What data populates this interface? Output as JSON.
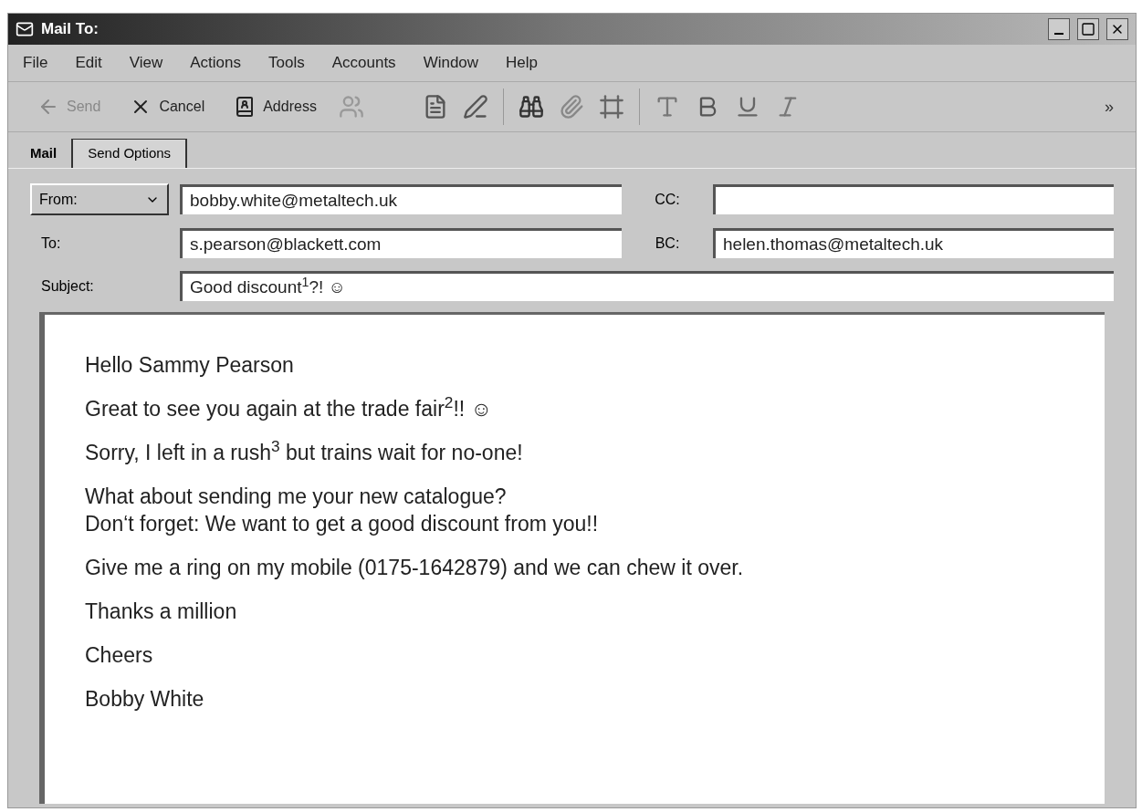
{
  "window": {
    "title": "Mail To:"
  },
  "menu": [
    "File",
    "Edit",
    "View",
    "Actions",
    "Tools",
    "Accounts",
    "Window",
    "Help"
  ],
  "toolbar": {
    "buttons": [
      {
        "label": "Send",
        "disabled": true
      },
      {
        "label": "Cancel",
        "disabled": false
      },
      {
        "label": "Address",
        "disabled": false
      }
    ],
    "overflow": "»"
  },
  "tabs": [
    {
      "label": "Mail",
      "selected": true
    },
    {
      "label": "Send Options",
      "selected": false
    }
  ],
  "header": {
    "from_label": "From:",
    "from": "bobby.white@metaltech.uk",
    "cc_label": "CC:",
    "to_label": "To:",
    "to": "s.pearson@blackett.com",
    "bcc_label": "BC:",
    "bcc": "helen.thomas@metaltech.uk",
    "subject_label": "Subject:",
    "subject": "Good discount$^{1}$?! ☺"
  },
  "body": [
    [
      "Hello Sammy Pearson"
    ],
    [
      "Great to see you again at the trade fair$^{2}$!! ☺"
    ],
    [
      "Sorry, I left in a rush$^{3}$ but trains wait for no-one!"
    ],
    [
      "What about sending me your new catalogue?",
      "Don‘t forget: We want to get a good discount from you!!"
    ],
    [
      "Give me a ring on my mobile (0175-1642879) and we can chew it over."
    ],
    [
      "Thanks a million"
    ],
    [
      "Cheers"
    ],
    [
      "Bobby White"
    ]
  ]
}
